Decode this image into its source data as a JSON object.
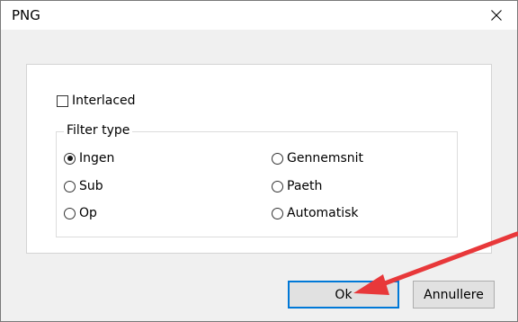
{
  "dialog": {
    "title": "PNG",
    "close_icon": "close-icon"
  },
  "options": {
    "interlaced_label": "Interlaced",
    "interlaced_checked": false
  },
  "filter_type": {
    "legend": "Filter type",
    "options": [
      {
        "label": "Ingen",
        "selected": true
      },
      {
        "label": "Sub",
        "selected": false
      },
      {
        "label": "Op",
        "selected": false
      },
      {
        "label": "Gennemsnit",
        "selected": false
      },
      {
        "label": "Paeth",
        "selected": false
      },
      {
        "label": "Automatisk",
        "selected": false
      }
    ]
  },
  "buttons": {
    "ok_label": "Ok",
    "cancel_label": "Annullere"
  },
  "annotation": {
    "arrow_color": "#e8383a"
  }
}
